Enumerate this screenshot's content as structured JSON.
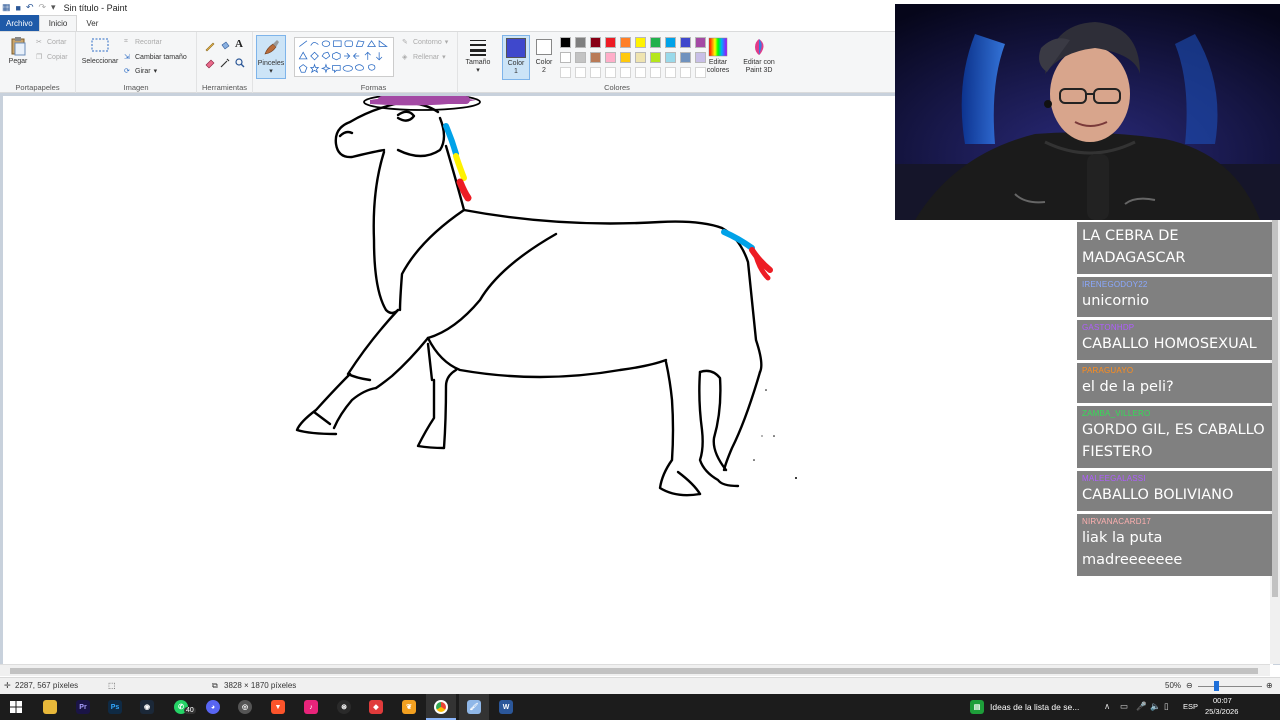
{
  "window": {
    "title": "Sin título - Paint"
  },
  "menu": {
    "file": "Archivo",
    "home": "Inicio",
    "view": "Ver"
  },
  "ribbon": {
    "clipboard": {
      "paste": "Pegar",
      "cut": "Cortar",
      "copy": "Copiar",
      "label": "Portapapeles"
    },
    "image": {
      "select": "Seleccionar",
      "crop": "Recortar",
      "resize": "Cambiar tamaño",
      "rotate": "Girar",
      "label": "Imagen"
    },
    "tools": {
      "label": "Herramientas"
    },
    "brushes": {
      "label": "Pinceles"
    },
    "shapes": {
      "outline": "Contorno",
      "fill": "Rellenar",
      "label": "Formas"
    },
    "size": {
      "label": "Tamaño"
    },
    "color1": {
      "label1": "Color",
      "label2": "1",
      "value": "#3f48cc"
    },
    "color2": {
      "label1": "Color",
      "label2": "2",
      "value": "#ffffff"
    },
    "colors": {
      "label": "Colores",
      "row1": [
        "#000000",
        "#7f7f7f",
        "#880015",
        "#ed1c24",
        "#ff7f27",
        "#fff200",
        "#22b14c",
        "#00a2e8",
        "#3f48cc",
        "#a349a4"
      ],
      "row2": [
        "#ffffff",
        "#c3c3c3",
        "#b97a57",
        "#ffaec9",
        "#ffc90e",
        "#efe4b0",
        "#b5e61d",
        "#99d9ea",
        "#7092be",
        "#c8bfe7"
      ],
      "row3": [
        "#ffffff",
        "#ffffff",
        "#ffffff",
        "#ffffff",
        "#ffffff",
        "#ffffff",
        "#ffffff",
        "#ffffff",
        "#ffffff",
        "#ffffff"
      ]
    },
    "edit_colors": {
      "line1": "Editar",
      "line2": "colores"
    },
    "paint3d": {
      "line1": "Editar con",
      "line2": "Paint 3D"
    }
  },
  "status": {
    "cursor_pos": "2287, 567 píxeles",
    "image_size": "3828 × 1870 píxeles",
    "zoom": "50%"
  },
  "taskbar": {
    "notification_text": "Ideas de la lista de se...",
    "whatsapp_badge": "40",
    "lang": "ESP",
    "time": "00:07",
    "date": "25/3/2026"
  },
  "chat": [
    {
      "user": "",
      "text": "LA CEBRA DE MADAGASCAR",
      "color": "#ffffff"
    },
    {
      "user": "IRENEGODOY22",
      "text": "unicornio",
      "color": "#8aa8ff"
    },
    {
      "user": "GASTONHDP",
      "text": "CABALLO HOMOSEXUAL",
      "color": "#b05cff"
    },
    {
      "user": "PARAGUAYO",
      "text": "el de la peli?",
      "color": "#ff8c1a"
    },
    {
      "user": "ZAMBA_VILLERO",
      "text": "GORDO GIL, ES CABALLO FIESTERO",
      "color": "#33dd55"
    },
    {
      "user": "MALEEGALASSI",
      "text": "CABALLO BOLIVIANO",
      "color": "#b05cff"
    },
    {
      "user": "NIRVANACARD17",
      "text": "liak la puta madreeeeeee",
      "color": "#ffb0b0"
    }
  ]
}
